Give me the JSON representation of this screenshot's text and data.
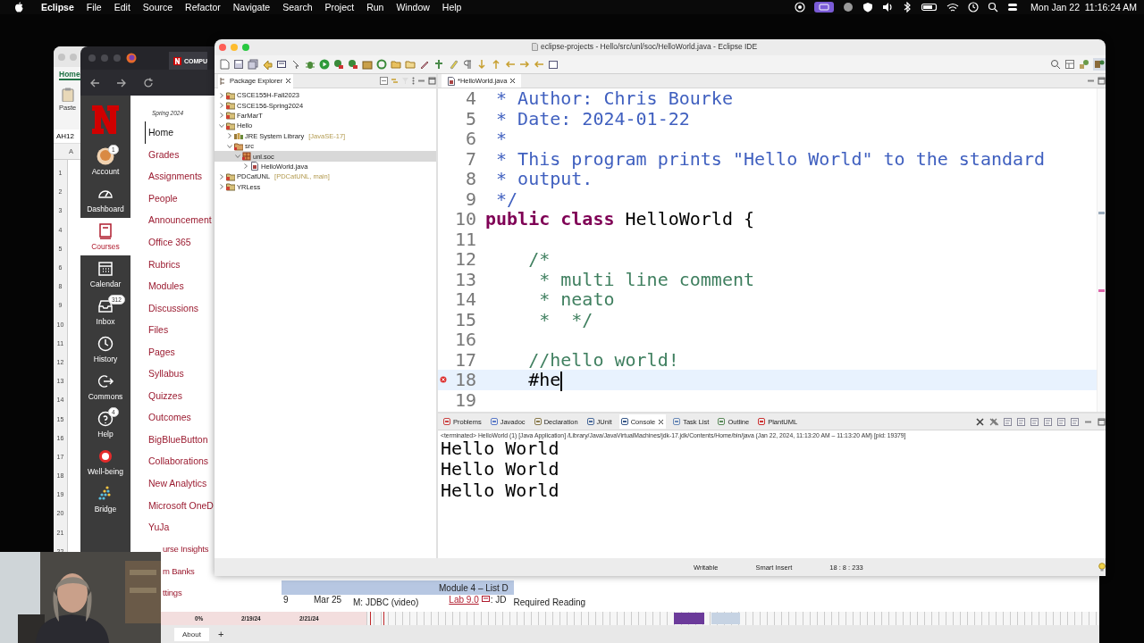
{
  "menu_bar": {
    "app_name": "Eclipse",
    "menus": [
      "File",
      "Edit",
      "Source",
      "Refactor",
      "Navigate",
      "Search",
      "Project",
      "Run",
      "Window",
      "Help"
    ],
    "clock": "Mon Jan 22  11:16:24 AM"
  },
  "spreadsheet": {
    "ribbon_tab": "Home",
    "paste_label": "Paste",
    "cell_reference": "AH12",
    "column_header": "A",
    "row_numbers": [
      "1",
      "2",
      "3",
      "4",
      "5",
      "6",
      "8",
      "9",
      "10",
      "11",
      "12",
      "13",
      "14",
      "15",
      "16",
      "17",
      "18",
      "19",
      "20",
      "21",
      "22"
    ],
    "gantt_row": {
      "percent": "0%",
      "start_date": "2/19/24",
      "end_date": "2/21/24"
    },
    "sheet_tabs": [
      {
        "label": "About",
        "selected": true
      }
    ],
    "add_sheet": "+"
  },
  "browser": {
    "tab_title": "COMPU",
    "global_nav": [
      {
        "label": "Account",
        "badge": "1",
        "selected": false
      },
      {
        "label": "Dashboard",
        "selected": false
      },
      {
        "label": "Courses",
        "selected": true
      },
      {
        "label": "Calendar",
        "selected": false
      },
      {
        "label": "Inbox",
        "badge": "312",
        "selected": false
      },
      {
        "label": "History",
        "selected": false
      },
      {
        "label": "Commons",
        "selected": false
      },
      {
        "label": "Help",
        "badge": "4",
        "selected": false
      },
      {
        "label": "Well-being",
        "selected": false
      },
      {
        "label": "Bridge",
        "selected": false
      }
    ],
    "term": "Spring 2024",
    "course_nav": [
      {
        "label": "Home",
        "selected": true
      },
      {
        "label": "Grades",
        "selected": false
      },
      {
        "label": "Assignments",
        "selected": false
      },
      {
        "label": "People",
        "selected": false
      },
      {
        "label": "Announcement",
        "selected": false
      },
      {
        "label": "Office 365",
        "selected": false
      },
      {
        "label": "Rubrics",
        "selected": false
      },
      {
        "label": "Modules",
        "selected": false
      },
      {
        "label": "Discussions",
        "selected": false
      },
      {
        "label": "Files",
        "selected": false
      },
      {
        "label": "Pages",
        "selected": false
      },
      {
        "label": "Syllabus",
        "selected": false
      },
      {
        "label": "Quizzes",
        "selected": false
      },
      {
        "label": "Outcomes",
        "selected": false
      },
      {
        "label": "BigBlueButton",
        "selected": false
      },
      {
        "label": "Collaborations",
        "selected": false
      },
      {
        "label": "New Analytics",
        "selected": false
      },
      {
        "label": "Microsoft OneD",
        "selected": false
      },
      {
        "label": "YuJa",
        "selected": false
      },
      {
        "label": "urse Insights",
        "selected": false
      },
      {
        "label": "m Banks",
        "selected": false
      },
      {
        "label": "ttings",
        "selected": false
      }
    ],
    "module": {
      "header": "Module 4 – List D",
      "number": "9",
      "date": "Mar 25",
      "items": [
        {
          "text": "M: JDBC (video)",
          "kind": "lower"
        },
        {
          "text": "Lab 9.0",
          "kind": "link"
        },
        {
          "text": ": JD",
          "kind": "plain"
        },
        {
          "text": "Required Reading",
          "kind": "lower"
        }
      ]
    }
  },
  "ide": {
    "window_title": "eclipse-projects - Hello/src/unl/soc/HelloWorld.java - Eclipse IDE",
    "package_explorer": {
      "title": "Package Explorer",
      "tree": [
        {
          "label": "CSCE155H-Fall2023",
          "kind": "project",
          "expanded": false,
          "selected": false
        },
        {
          "label": "CSCE156-Spring2024",
          "kind": "project",
          "expanded": false,
          "selected": false
        },
        {
          "label": "FarMarT",
          "kind": "project",
          "expanded": false,
          "selected": false
        },
        {
          "label": "Hello",
          "kind": "project",
          "expanded": true,
          "selected": false,
          "children": [
            {
              "label": "JRE System Library",
              "decoration": "[JavaSE-17]",
              "kind": "library",
              "expanded": false,
              "selected": false
            },
            {
              "label": "src",
              "kind": "source",
              "expanded": true,
              "selected": false,
              "children": [
                {
                  "label": "unl.soc",
                  "kind": "package",
                  "expanded": true,
                  "selected": true,
                  "children": [
                    {
                      "label": "HelloWorld.java",
                      "kind": "file",
                      "expanded": false,
                      "selected": false
                    }
                  ]
                }
              ]
            }
          ]
        },
        {
          "label": "PDCatUNL",
          "decoration": "[PDCatUNL, main]",
          "kind": "project",
          "expanded": false,
          "selected": false
        },
        {
          "label": "YRLess",
          "kind": "project",
          "expanded": false,
          "selected": false
        }
      ]
    },
    "editor": {
      "tab": {
        "label": "*HelloWorld.java",
        "selected": true
      },
      "lines": [
        {
          "number": "4",
          "tokens": [
            {
              "text": " * Author: Chris Bourke",
              "kind": "javadoc"
            }
          ]
        },
        {
          "number": "5",
          "tokens": [
            {
              "text": " * Date: 2024-01-22",
              "kind": "javadoc"
            }
          ]
        },
        {
          "number": "6",
          "tokens": [
            {
              "text": " *",
              "kind": "javadoc"
            }
          ]
        },
        {
          "number": "7",
          "tokens": [
            {
              "text": " * This program prints \"Hello World\" to the standard",
              "kind": "javadoc"
            }
          ]
        },
        {
          "number": "8",
          "tokens": [
            {
              "text": " * output.",
              "kind": "javadoc"
            }
          ]
        },
        {
          "number": "9",
          "tokens": [
            {
              "text": " */",
              "kind": "javadoc"
            }
          ]
        },
        {
          "number": "10",
          "tokens": [
            {
              "text": "public class",
              "kind": "keyword"
            },
            {
              "text": " HelloWorld {",
              "kind": "plain"
            }
          ]
        },
        {
          "number": "11"
        },
        {
          "number": "12",
          "tokens": [
            {
              "text": "    /*",
              "kind": "comment"
            }
          ]
        },
        {
          "number": "13",
          "tokens": [
            {
              "text": "     * multi line comment",
              "kind": "comment"
            }
          ]
        },
        {
          "number": "14",
          "tokens": [
            {
              "text": "     * neato",
              "kind": "comment"
            }
          ]
        },
        {
          "number": "15",
          "tokens": [
            {
              "text": "     *  */",
              "kind": "comment"
            }
          ]
        },
        {
          "number": "16"
        },
        {
          "number": "17",
          "tokens": [
            {
              "text": "    //hello world!",
              "kind": "comment"
            }
          ]
        },
        {
          "number": "18",
          "tokens": [
            {
              "text": "    #he",
              "kind": "plain"
            }
          ],
          "current": true,
          "error": true
        },
        {
          "number": "19"
        }
      ]
    },
    "bottom_panel": {
      "tabs": [
        {
          "label": "Problems",
          "selected": false
        },
        {
          "label": "Javadoc",
          "selected": false
        },
        {
          "label": "Declaration",
          "selected": false
        },
        {
          "label": "JUnit",
          "selected": false
        },
        {
          "label": "Console",
          "selected": true
        },
        {
          "label": "Task List",
          "selected": false
        },
        {
          "label": "Outline",
          "selected": false
        },
        {
          "label": "PlantUML",
          "selected": false
        }
      ],
      "status_line": "<terminated> HelloWorld (1) [Java Application] /Library/Java/JavaVirtualMachines/jdk-17.jdk/Contents/Home/bin/java  (Jan 22, 2024, 11:13:20 AM – 11:13:20 AM) [pid: 19379]",
      "output": [
        "Hello World",
        "Hello World",
        "Hello World"
      ]
    },
    "status_bar": [
      "Writable",
      "Smart Insert",
      "18 : 8 : 233"
    ]
  }
}
